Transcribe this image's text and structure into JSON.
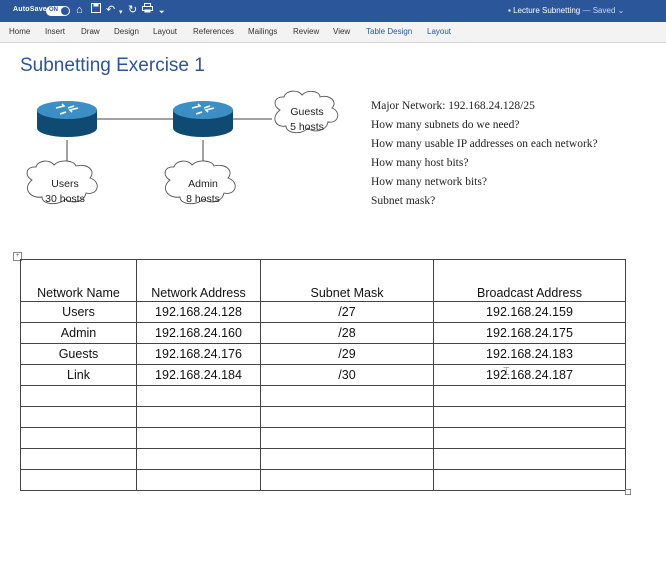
{
  "titlebar": {
    "autosave_label": "AutoSave",
    "autosave_state": "ON",
    "document_title": "Lecture Subnetting",
    "save_status": "— Saved",
    "quick_access_icons": [
      "home-icon",
      "save-icon",
      "undo-icon",
      "redo-icon",
      "print-icon",
      "customize-icon"
    ],
    "background_color": "#2b579a"
  },
  "ribbon": {
    "tabs": [
      "Home",
      "Insert",
      "Draw",
      "Design",
      "Layout",
      "References",
      "Mailings",
      "Review",
      "View",
      "Table Design",
      "Layout"
    ]
  },
  "document": {
    "title": "Subnetting Exercise 1",
    "diagram": {
      "clouds": {
        "guests": {
          "line1": "Guests",
          "line2": "5 hosts"
        },
        "users": {
          "line1": "Users",
          "line2": "30 hosts"
        },
        "admin": {
          "line1": "Admin",
          "line2": "8 hosts"
        }
      }
    },
    "questions": [
      "Major Network: 192.168.24.128/25",
      "How many subnets do we need?",
      "How many usable IP addresses on each network?",
      "How many host bits?",
      "How many network bits?",
      "Subnet mask?"
    ],
    "table": {
      "headers": [
        "Network Name",
        "Network Address",
        "Subnet Mask",
        "Broadcast Address"
      ],
      "rows": [
        [
          "Users",
          "192.168.24.128",
          "/27",
          "192.168.24.159"
        ],
        [
          "Admin",
          "192.168.24.160",
          "/28",
          "192.168.24.175"
        ],
        [
          "Guests",
          "192.168.24.176",
          "/29",
          "192.168.24.183"
        ],
        [
          "Link",
          "192.168.24.184",
          "/30",
          "192.168.24.187"
        ],
        [
          "",
          "",
          "",
          ""
        ],
        [
          "",
          "",
          "",
          ""
        ],
        [
          "",
          "",
          "",
          ""
        ],
        [
          "",
          "",
          "",
          ""
        ],
        [
          "",
          "",
          "",
          ""
        ]
      ]
    }
  }
}
